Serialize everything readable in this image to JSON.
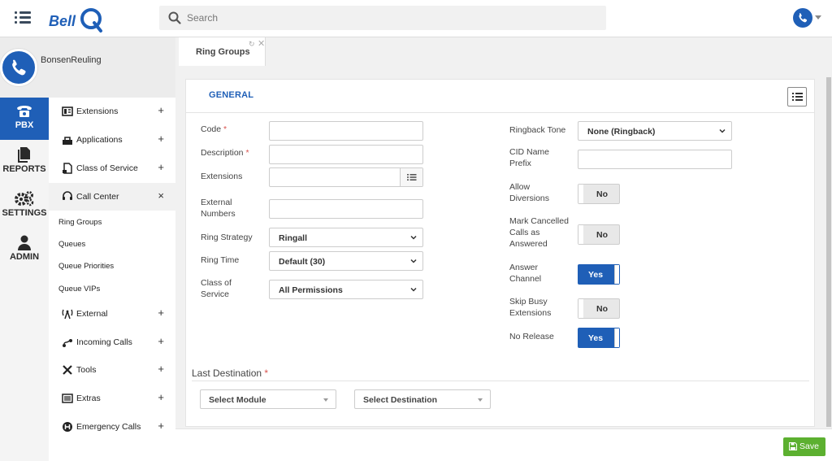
{
  "brand": {
    "name": "BellQ",
    "accent": "#1f5fb7",
    "save_color": "#5cb030"
  },
  "header": {
    "search_placeholder": "Search"
  },
  "user": {
    "name": "BonsenReuling"
  },
  "rail": [
    {
      "label": "PBX",
      "icon": "phone-icon",
      "active": true
    },
    {
      "label": "REPORTS",
      "icon": "reports-icon",
      "active": false
    },
    {
      "label": "SETTINGS",
      "icon": "gears-icon",
      "active": false
    },
    {
      "label": "ADMIN",
      "icon": "admin-icon",
      "active": false
    }
  ],
  "menu": {
    "items": [
      {
        "label": "Extensions",
        "icon": "extensions-icon",
        "toggle": "+"
      },
      {
        "label": "Applications",
        "icon": "applications-icon",
        "toggle": "+"
      },
      {
        "label": "Class of Service",
        "icon": "class-of-service-icon",
        "toggle": "+"
      },
      {
        "label": "Call Center",
        "icon": "headset-icon",
        "toggle": "×"
      },
      {
        "label": "External",
        "icon": "antenna-icon",
        "toggle": "+"
      },
      {
        "label": "Incoming Calls",
        "icon": "incoming-calls-icon",
        "toggle": "+"
      },
      {
        "label": "Tools",
        "icon": "tools-icon",
        "toggle": "+"
      },
      {
        "label": "Extras",
        "icon": "extras-icon",
        "toggle": "+"
      },
      {
        "label": "Emergency Calls",
        "icon": "emergency-icon",
        "toggle": "+"
      }
    ],
    "call_center_sub": [
      "Ring Groups",
      "Queues",
      "Queue Priorities",
      "Queue VIPs"
    ]
  },
  "tab": {
    "label": "Ring Groups"
  },
  "form": {
    "section": "GENERAL",
    "required_mark": "*",
    "left": {
      "code": {
        "label": "Code",
        "value": ""
      },
      "description": {
        "label": "Description",
        "value": ""
      },
      "extensions": {
        "label": "Extensions",
        "value": ""
      },
      "external_numbers": {
        "label": "External Numbers",
        "value": ""
      },
      "ring_strategy": {
        "label": "Ring Strategy",
        "value": "Ringall"
      },
      "ring_time": {
        "label": "Ring Time",
        "value": "Default (30)"
      },
      "class_of_service": {
        "label": "Class of Service",
        "value": "All Permissions"
      }
    },
    "right": {
      "ringback_tone": {
        "label": "Ringback Tone",
        "value": "None (Ringback)"
      },
      "cid_name_prefix": {
        "label": "CID Name Prefix",
        "value": ""
      },
      "allow_diversions": {
        "label": "Allow Diversions",
        "value": "No"
      },
      "mark_cancelled": {
        "label": "Mark Cancelled Calls as Answered",
        "value": "No"
      },
      "answer_channel": {
        "label": "Answer Channel",
        "value": "Yes"
      },
      "skip_busy": {
        "label": "Skip Busy Extensions",
        "value": "No"
      },
      "no_release": {
        "label": "No Release",
        "value": "Yes"
      }
    },
    "last_destination": {
      "title": "Last Destination",
      "module_placeholder": "Select Module",
      "destination_placeholder": "Select Destination"
    }
  },
  "footer": {
    "save_label": "Save"
  }
}
